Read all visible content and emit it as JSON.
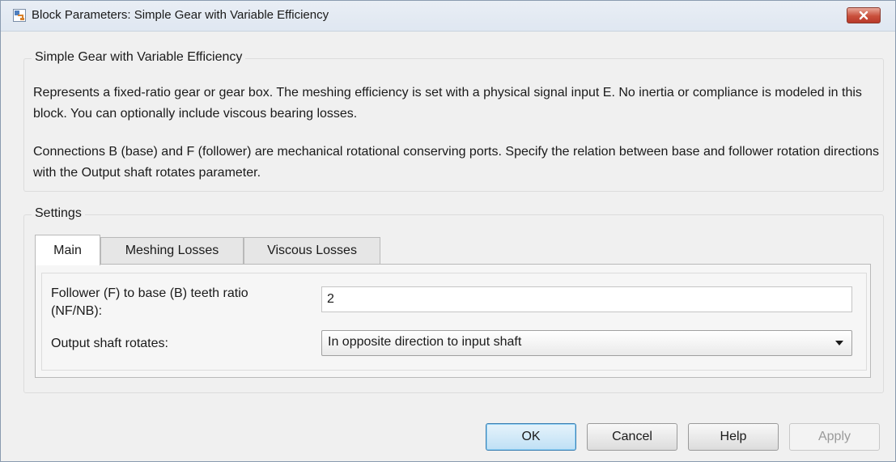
{
  "window": {
    "title": "Block Parameters: Simple Gear with Variable Efficiency"
  },
  "description_group": {
    "title": "Simple Gear with Variable Efficiency",
    "paragraph1": "Represents a fixed-ratio gear or gear box. The meshing efficiency is set with a physical signal input E. No inertia or compliance is modeled in this block. You can optionally include viscous bearing losses.",
    "paragraph2": "Connections B (base) and F (follower) are mechanical rotational conserving ports. Specify the relation between base and follower rotation directions with the Output shaft rotates parameter."
  },
  "settings": {
    "title": "Settings",
    "tabs": [
      {
        "label": "Main",
        "active": true
      },
      {
        "label": "Meshing Losses",
        "active": false
      },
      {
        "label": "Viscous Losses",
        "active": false
      }
    ],
    "teeth_ratio": {
      "label_line1": "Follower (F) to base (B) teeth ratio",
      "label_line2": "(NF/NB):",
      "value": "2"
    },
    "output_shaft": {
      "label": "Output shaft rotates:",
      "selected": "In opposite direction to input shaft"
    }
  },
  "buttons": {
    "ok": "OK",
    "cancel": "Cancel",
    "help": "Help",
    "apply": "Apply"
  },
  "colors": {
    "close_button": "#c9503b",
    "default_button_border": "#3c7fb1"
  }
}
